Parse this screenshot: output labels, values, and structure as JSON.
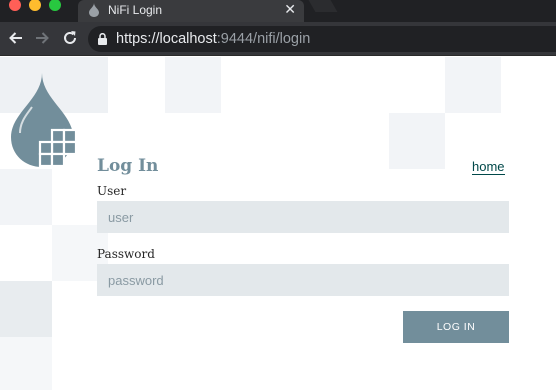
{
  "browser": {
    "tab_title": "NiFi Login",
    "tab_close": "✕",
    "url_scheme": "https://",
    "url_host": "localhost",
    "url_rest": ":9444/nifi/login"
  },
  "login": {
    "title": "Log In",
    "home_link": "home",
    "user_label": "User",
    "user_placeholder": "user",
    "user_value": "",
    "password_label": "Password",
    "password_placeholder": "password",
    "password_value": "",
    "submit_label": "LOG IN"
  },
  "icons": {
    "logo": "nifi-drop-logo",
    "back": "arrow-left-icon",
    "forward": "arrow-right-icon",
    "reload": "reload-icon",
    "lock": "lock-icon"
  },
  "colors": {
    "accent": "#728e9b",
    "link": "#004849",
    "input_bg": "#e3e8eb"
  }
}
